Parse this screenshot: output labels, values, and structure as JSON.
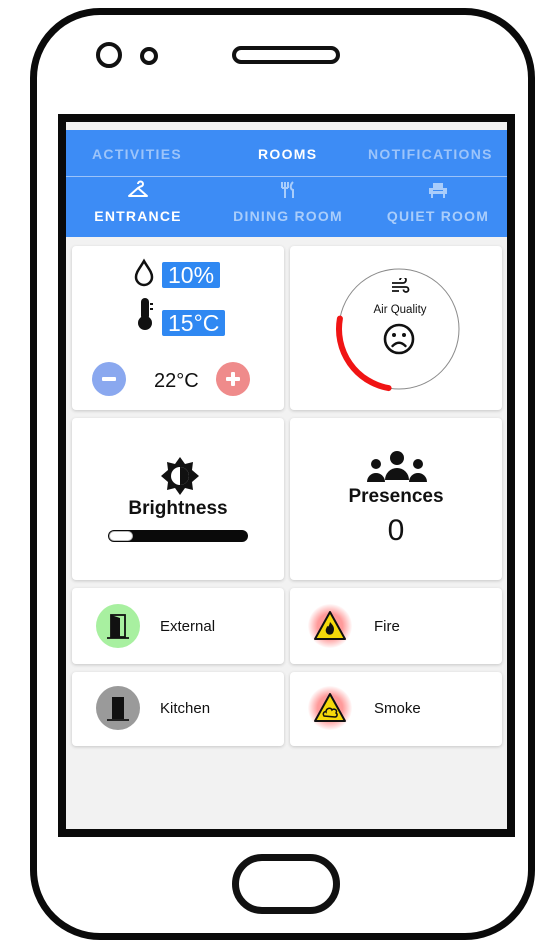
{
  "tabs": {
    "top": [
      "ACTIVITIES",
      "ROOMS",
      "NOTIFICATIONS"
    ],
    "active_top": "ROOMS",
    "rooms": [
      {
        "label": "ENTRANCE",
        "icon": "hanger-icon"
      },
      {
        "label": "DINING ROOM",
        "icon": "fork-knife-icon"
      },
      {
        "label": "QUIET ROOM",
        "icon": "armchair-icon"
      }
    ],
    "active_room": "ENTRANCE"
  },
  "climate": {
    "humidity": "10%",
    "temperature": "15°C",
    "setpoint": "22°C"
  },
  "air_quality": {
    "label": "Air Quality",
    "level": 0.25,
    "status": "bad",
    "arc_color": "#f01414"
  },
  "brightness": {
    "label": "Brightness",
    "level": 0.12
  },
  "presences": {
    "label": "Presences",
    "count": "0"
  },
  "sensors": [
    {
      "name": "External",
      "icon": "open-door-icon",
      "state": "open",
      "badge_color": "#a8f0a0"
    },
    {
      "name": "Fire",
      "icon": "fire-warning-icon",
      "state": "alarm",
      "badge_color": "#ff9a9a"
    },
    {
      "name": "Kitchen",
      "icon": "closed-door-icon",
      "state": "closed",
      "badge_color": "#9a9a9a"
    },
    {
      "name": "Smoke",
      "icon": "smoke-warning-icon",
      "state": "alarm",
      "badge_color": "#ff9a9a"
    }
  ],
  "colors": {
    "accent": "#3d8cf5",
    "pill": "#2f88f2",
    "minus": "#8aa8ef",
    "plus": "#ef8b8b",
    "alarm": "#f01414"
  }
}
